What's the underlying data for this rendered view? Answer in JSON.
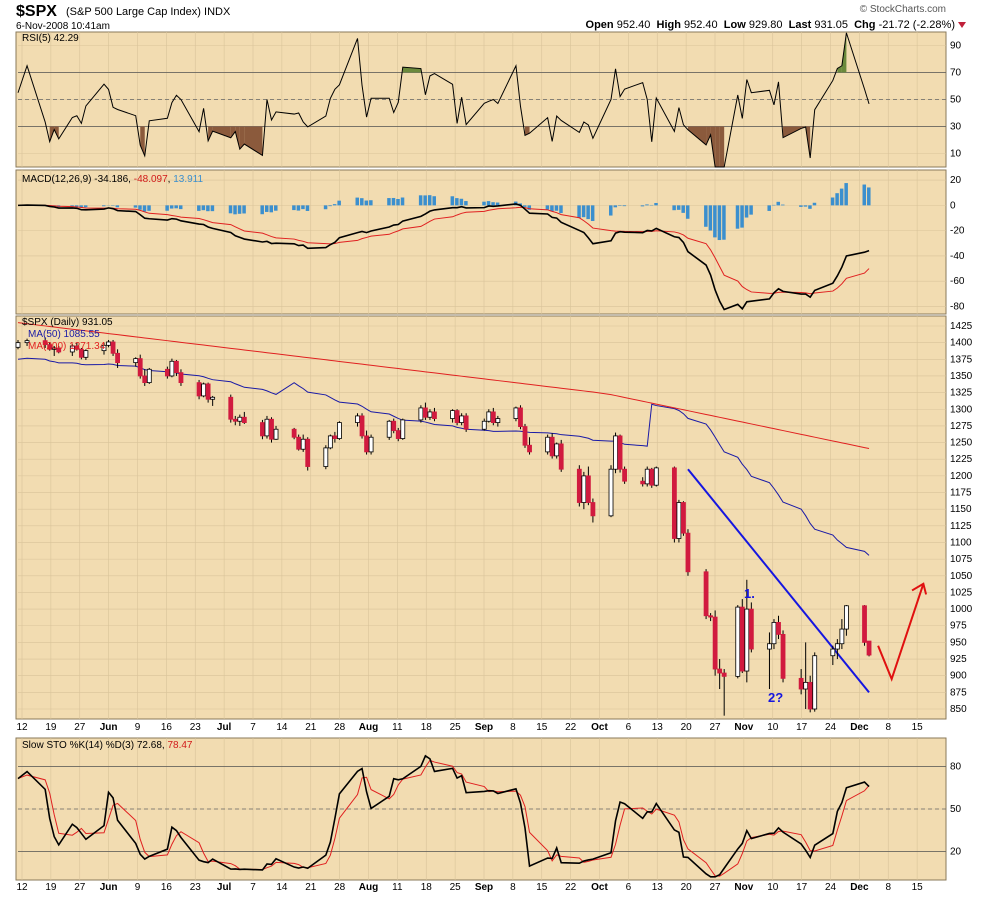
{
  "header": {
    "symbol": "$SPX",
    "name": "(S&P 500 Large Cap Index)",
    "exchange": "INDX",
    "datetime": "6-Nov-2008 10:41am",
    "open_label": "Open",
    "open": "952.40",
    "high_label": "High",
    "high": "952.40",
    "low_label": "Low",
    "low": "929.80",
    "last_label": "Last",
    "last": "931.05",
    "chg_label": "Chg",
    "chg": "-21.72 (-2.28%)",
    "brand": "© StockCharts.com"
  },
  "colors": {
    "panel_bg": "#f2dcb1",
    "grid": "#d9c39a",
    "up": "#ffffff",
    "down": "#d11a3f",
    "ma50": "#1a1aa6",
    "ma200": "#e02020",
    "macd_hist": "#3b8fce",
    "rsi_fill": "#8b5a3c",
    "trend_line": "#1616e0",
    "projection": "#e01010"
  },
  "panels": {
    "rsi": {
      "label": "RSI(5) 42.29"
    },
    "macd": {
      "label": "MACD(12,26,9)",
      "v1": "-34.186",
      "v2": "-48.097",
      "v3": "13.911"
    },
    "price": {
      "label": "$SPX (Daily) 931.05",
      "ma50": "MA(50) 1085.55",
      "ma200": "MA(200) 1271.34"
    },
    "sto": {
      "label": "Slow STO %K(14) %D(3)",
      "v1": "72.68",
      "v2": "78.47"
    }
  },
  "annotations": {
    "label1": "1.",
    "label2": "2?"
  },
  "chart_data": {
    "type": "line",
    "series": [
      {
        "name": "$SPX (Daily)",
        "type": "candlestick"
      },
      {
        "name": "MA(50)",
        "last": 1085.55
      },
      {
        "name": "MA(200)",
        "last": 1271.34
      },
      {
        "name": "RSI(5)",
        "last": 42.29
      },
      {
        "name": "MACD(12,26,9)",
        "macd": -34.186,
        "signal": -48.097,
        "hist": 13.911
      },
      {
        "name": "Slow STO %K(14) %D(3)",
        "k": 72.68,
        "d": 78.47
      }
    ],
    "x_ticks": [
      "12",
      "19",
      "27",
      "Jun",
      "9",
      "16",
      "23",
      "Jul",
      "7",
      "14",
      "21",
      "28",
      "Aug",
      "11",
      "18",
      "25",
      "Sep",
      "8",
      "15",
      "22",
      "Oct",
      "6",
      "13",
      "20",
      "27",
      "Nov",
      "10",
      "17",
      "24",
      "Dec",
      "8",
      "15"
    ],
    "price_ticks": [
      1425,
      1400,
      1375,
      1350,
      1325,
      1300,
      1275,
      1250,
      1225,
      1200,
      1175,
      1150,
      1125,
      1100,
      1075,
      1050,
      1025,
      1000,
      975,
      950,
      925,
      900,
      875,
      850
    ],
    "rsi_ticks": [
      90,
      70,
      50,
      30,
      10
    ],
    "macd_ticks": [
      20,
      0,
      -20,
      -40,
      -60,
      -80
    ],
    "sto_ticks": [
      80,
      50,
      20
    ],
    "price_ylim": [
      835,
      1440
    ],
    "rsi_ylim": [
      0,
      100
    ],
    "macd_ylim": [
      -86,
      28
    ],
    "sto_ylim": [
      0,
      100
    ],
    "xlim_days": [
      0,
      205
    ],
    "candles": [
      [
        0,
        1393,
        1404,
        1390,
        1400
      ],
      [
        2,
        1400,
        1406,
        1395,
        1403
      ],
      [
        6,
        1403,
        1408,
        1392,
        1397
      ],
      [
        7,
        1397,
        1401,
        1388,
        1390
      ],
      [
        8,
        1390,
        1395,
        1380,
        1392
      ],
      [
        9,
        1392,
        1395,
        1384,
        1386
      ],
      [
        12,
        1386,
        1398,
        1380,
        1395
      ],
      [
        13,
        1395,
        1400,
        1388,
        1390
      ],
      [
        14,
        1390,
        1392,
        1375,
        1378
      ],
      [
        15,
        1378,
        1390,
        1374,
        1388
      ],
      [
        19,
        1388,
        1400,
        1382,
        1396
      ],
      [
        20,
        1396,
        1404,
        1393,
        1401
      ],
      [
        21,
        1401,
        1404,
        1380,
        1384
      ],
      [
        22,
        1384,
        1390,
        1362,
        1370
      ],
      [
        26,
        1370,
        1378,
        1364,
        1376
      ],
      [
        27,
        1376,
        1382,
        1346,
        1350
      ],
      [
        28,
        1350,
        1360,
        1335,
        1340
      ],
      [
        29,
        1340,
        1362,
        1338,
        1360
      ],
      [
        33,
        1360,
        1364,
        1346,
        1350
      ],
      [
        34,
        1350,
        1376,
        1348,
        1372
      ],
      [
        35,
        1372,
        1374,
        1350,
        1355
      ],
      [
        36,
        1355,
        1360,
        1335,
        1340
      ],
      [
        40,
        1340,
        1344,
        1315,
        1320
      ],
      [
        41,
        1320,
        1340,
        1318,
        1338
      ],
      [
        42,
        1338,
        1340,
        1310,
        1315
      ],
      [
        43,
        1315,
        1320,
        1305,
        1318
      ],
      [
        47,
        1318,
        1322,
        1280,
        1285
      ],
      [
        48,
        1285,
        1290,
        1276,
        1282
      ],
      [
        49,
        1282,
        1292,
        1275,
        1288
      ],
      [
        50,
        1288,
        1296,
        1278,
        1280
      ],
      [
        54,
        1280,
        1284,
        1255,
        1260
      ],
      [
        55,
        1260,
        1290,
        1256,
        1285
      ],
      [
        56,
        1285,
        1288,
        1250,
        1255
      ],
      [
        57,
        1255,
        1275,
        1254,
        1270
      ],
      [
        61,
        1270,
        1272,
        1255,
        1258
      ],
      [
        62,
        1258,
        1262,
        1238,
        1240
      ],
      [
        63,
        1240,
        1262,
        1236,
        1255
      ],
      [
        64,
        1255,
        1258,
        1208,
        1214
      ],
      [
        68,
        1214,
        1246,
        1210,
        1242
      ],
      [
        69,
        1242,
        1262,
        1240,
        1260
      ],
      [
        70,
        1260,
        1266,
        1250,
        1256
      ],
      [
        71,
        1256,
        1282,
        1254,
        1280
      ],
      [
        75,
        1280,
        1294,
        1274,
        1290
      ],
      [
        76,
        1290,
        1294,
        1256,
        1260
      ],
      [
        77,
        1260,
        1268,
        1232,
        1236
      ],
      [
        78,
        1236,
        1262,
        1232,
        1258
      ],
      [
        82,
        1258,
        1284,
        1254,
        1282
      ],
      [
        83,
        1282,
        1286,
        1264,
        1268
      ],
      [
        84,
        1268,
        1272,
        1252,
        1256
      ],
      [
        85,
        1256,
        1286,
        1254,
        1284
      ],
      [
        89,
        1284,
        1306,
        1280,
        1302
      ],
      [
        90,
        1302,
        1310,
        1284,
        1288
      ],
      [
        91,
        1288,
        1300,
        1284,
        1296
      ],
      [
        92,
        1296,
        1302,
        1282,
        1286
      ],
      [
        96,
        1286,
        1300,
        1280,
        1298
      ],
      [
        97,
        1298,
        1300,
        1276,
        1280
      ],
      [
        98,
        1280,
        1294,
        1276,
        1290
      ],
      [
        99,
        1290,
        1294,
        1266,
        1270
      ],
      [
        103,
        1270,
        1286,
        1268,
        1282
      ],
      [
        104,
        1282,
        1300,
        1280,
        1296
      ],
      [
        105,
        1296,
        1302,
        1276,
        1280
      ],
      [
        106,
        1280,
        1290,
        1274,
        1286
      ],
      [
        110,
        1286,
        1304,
        1282,
        1302
      ],
      [
        111,
        1302,
        1306,
        1270,
        1274
      ],
      [
        112,
        1274,
        1278,
        1242,
        1246
      ],
      [
        113,
        1246,
        1258,
        1232,
        1236
      ],
      [
        117,
        1236,
        1262,
        1232,
        1258
      ],
      [
        118,
        1258,
        1264,
        1226,
        1230
      ],
      [
        119,
        1230,
        1250,
        1226,
        1248
      ],
      [
        120,
        1248,
        1254,
        1206,
        1210
      ],
      [
        124,
        1210,
        1216,
        1154,
        1160
      ],
      [
        125,
        1160,
        1206,
        1150,
        1200
      ],
      [
        126,
        1200,
        1214,
        1156,
        1160
      ],
      [
        127,
        1160,
        1166,
        1130,
        1140
      ],
      [
        131,
        1140,
        1216,
        1138,
        1210
      ],
      [
        132,
        1210,
        1265,
        1204,
        1260
      ],
      [
        133,
        1260,
        1262,
        1205,
        1210
      ],
      [
        134,
        1210,
        1214,
        1188,
        1192
      ],
      [
        138,
        1192,
        1198,
        1184,
        1188
      ],
      [
        139,
        1188,
        1214,
        1184,
        1210
      ],
      [
        140,
        1210,
        1212,
        1182,
        1186
      ],
      [
        141,
        1186,
        1214,
        1184,
        1212
      ],
      [
        145,
        1212,
        1214,
        1100,
        1106
      ],
      [
        146,
        1106,
        1164,
        1100,
        1160
      ],
      [
        147,
        1160,
        1162,
        1110,
        1114
      ],
      [
        148,
        1114,
        1120,
        1050,
        1056
      ],
      [
        152,
        1056,
        1060,
        985,
        990
      ],
      [
        153,
        990,
        994,
        982,
        988
      ],
      [
        154,
        988,
        998,
        900,
        910
      ],
      [
        155,
        910,
        925,
        880,
        904
      ],
      [
        156,
        904,
        910,
        840,
        899
      ],
      [
        159,
        899,
        1006,
        896,
        1003
      ],
      [
        160,
        1003,
        1015,
        904,
        907
      ],
      [
        161,
        907,
        1044,
        890,
        1000
      ],
      [
        162,
        1000,
        1010,
        935,
        940
      ],
      [
        166,
        940,
        965,
        880,
        948
      ],
      [
        167,
        948,
        985,
        940,
        980
      ],
      [
        168,
        980,
        990,
        955,
        962
      ],
      [
        169,
        962,
        968,
        890,
        896
      ],
      [
        173,
        896,
        910,
        872,
        880
      ],
      [
        174,
        880,
        950,
        850,
        890
      ],
      [
        175,
        890,
        900,
        845,
        850
      ],
      [
        176,
        850,
        935,
        846,
        930
      ],
      [
        180,
        930,
        945,
        916,
        940
      ],
      [
        181,
        940,
        955,
        925,
        948
      ],
      [
        182,
        948,
        985,
        940,
        970
      ],
      [
        183,
        970,
        1006,
        960,
        1005
      ],
      [
        187,
        1005,
        1006,
        945,
        950
      ],
      [
        188,
        952,
        952,
        929,
        931
      ]
    ]
  }
}
